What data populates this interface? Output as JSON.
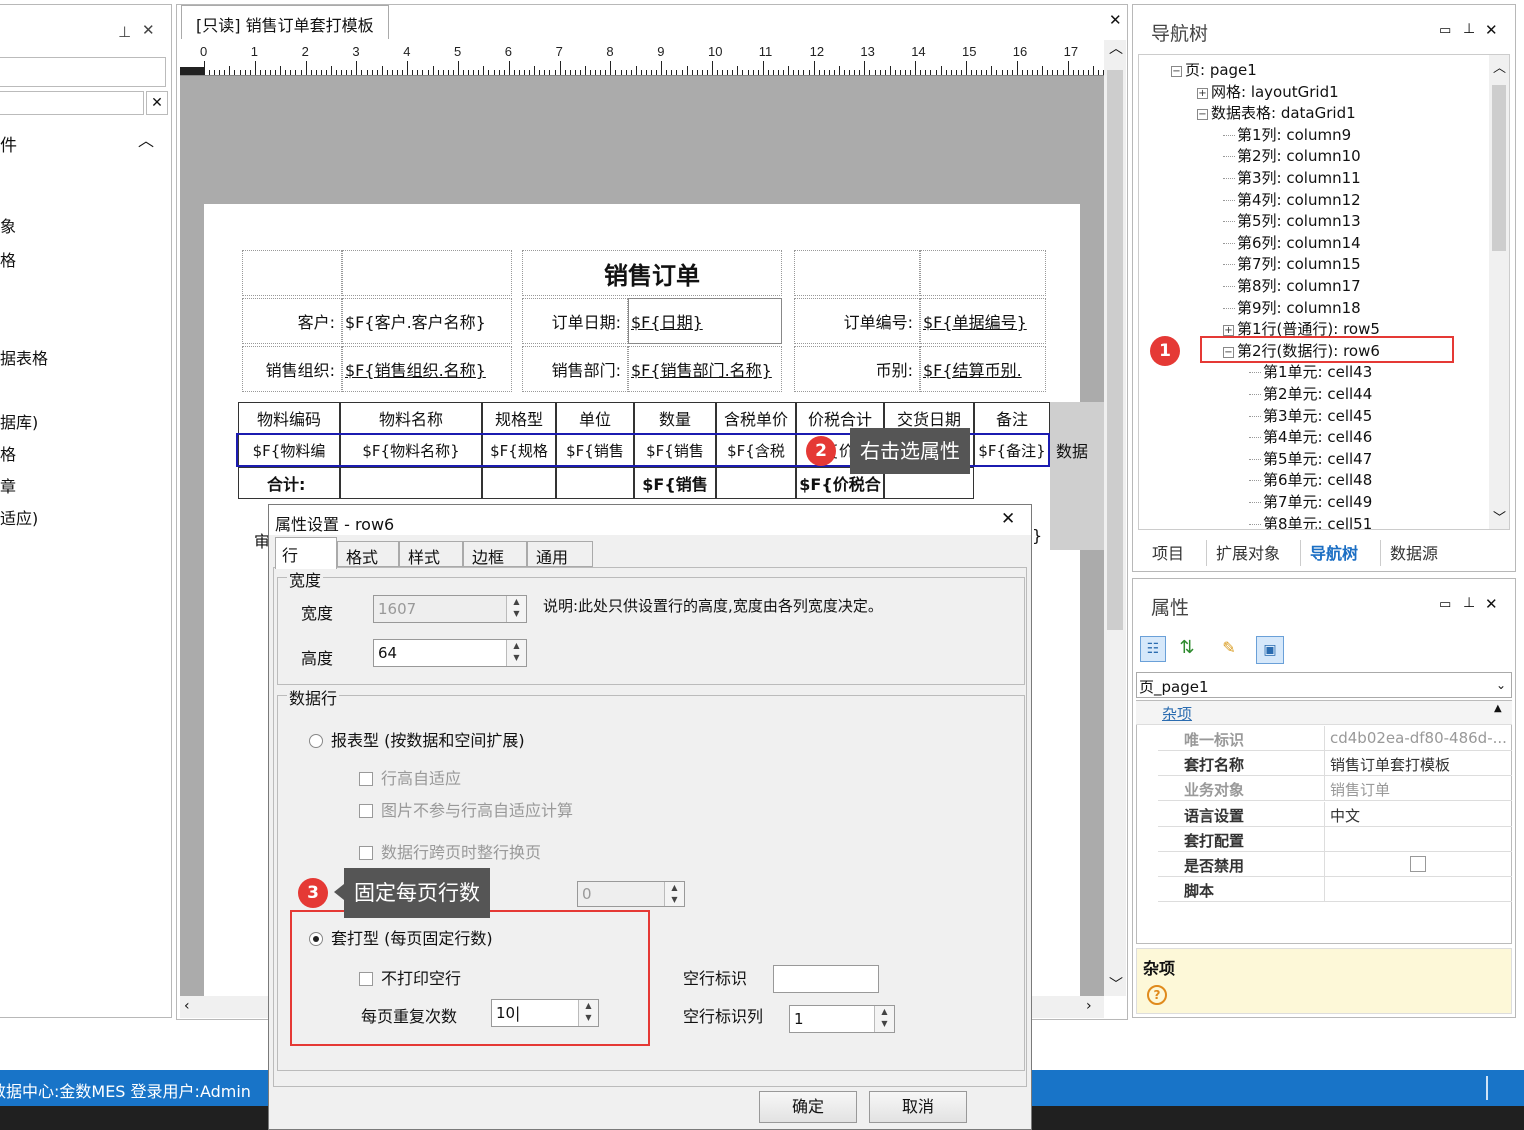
{
  "left_panel": {
    "fragments": [
      "件",
      "象",
      "格",
      "据表格",
      "据库)",
      "格",
      "章",
      "适应)"
    ]
  },
  "document_tab": {
    "title": "[只读] 销售订单套打模板"
  },
  "ruler": {
    "ticks": [
      "0",
      "1",
      "2",
      "3",
      "4",
      "5",
      "6",
      "7",
      "8",
      "9",
      "10",
      "11",
      "12",
      "13",
      "14",
      "15",
      "16",
      "17"
    ]
  },
  "report": {
    "title": "销售订单",
    "labels": {
      "customer": "客户:",
      "order_date": "订单日期:",
      "order_no": "订单编号:",
      "sales_org": "销售组织:",
      "sales_dept": "销售部门:",
      "currency": "币别:"
    },
    "fields": {
      "customer": "$F{客户.客户名称}",
      "order_date": "$F{日期}",
      "order_no": "$F{单据编号}",
      "sales_org": "$F{销售组织.名称}",
      "sales_dept": "$F{销售部门.名称}",
      "currency": "$F{结算币别."
    },
    "headers": [
      "物料编码",
      "物料名称",
      "规格型",
      "单位",
      "数量",
      "含税单价",
      "价税合计",
      "交货日期",
      "备注"
    ],
    "data_row": [
      "$F{物料编",
      "$F{物料名称}",
      "$F{规格",
      "$F{销售",
      "$F{销售",
      "$F{含税",
      "$F{价税",
      "",
      "$F{备注}"
    ],
    "data_row_tag": "数据",
    "total_label": "合计:",
    "total_qty": "$F{销售",
    "total_amount": "$F{价税合",
    "partial_label": "审",
    "partial_right": "}"
  },
  "nav_tree": {
    "title": "导航树",
    "nodes": [
      {
        "text": "页: page1",
        "expander": "−"
      },
      {
        "text": "网格: layoutGrid1",
        "expander": "+"
      },
      {
        "text": "数据表格: dataGrid1",
        "expander": "−"
      },
      {
        "text": "第1列: column9",
        "expander": ""
      },
      {
        "text": "第2列: column10",
        "expander": ""
      },
      {
        "text": "第3列: column11",
        "expander": ""
      },
      {
        "text": "第4列: column12",
        "expander": ""
      },
      {
        "text": "第5列: column13",
        "expander": ""
      },
      {
        "text": "第6列: column14",
        "expander": ""
      },
      {
        "text": "第7列: column15",
        "expander": ""
      },
      {
        "text": "第8列: column17",
        "expander": ""
      },
      {
        "text": "第9列: column18",
        "expander": ""
      },
      {
        "text": "第1行(普通行): row5",
        "expander": "+"
      },
      {
        "text": "第2行(数据行): row6",
        "expander": "−"
      },
      {
        "text": "第1单元: cell43",
        "expander": ""
      },
      {
        "text": "第2单元: cell44",
        "expander": ""
      },
      {
        "text": "第3单元: cell45",
        "expander": ""
      },
      {
        "text": "第4单元: cell46",
        "expander": ""
      },
      {
        "text": "第5单元: cell47",
        "expander": ""
      },
      {
        "text": "第6单元: cell48",
        "expander": ""
      },
      {
        "text": "第7单元: cell49",
        "expander": ""
      },
      {
        "text": "第8单元: cell51",
        "expander": ""
      }
    ],
    "tabs": [
      "项目",
      "扩展对象",
      "导航树",
      "数据源"
    ],
    "active_tab": "导航树"
  },
  "properties": {
    "title": "属性",
    "selector": "页_page1",
    "category": "杂项",
    "rows": [
      {
        "key": "唯一标识",
        "value": "cd4b02ea-df80-486d-...",
        "disabled": true
      },
      {
        "key": "套打名称",
        "value": "销售订单套打模板",
        "disabled": false
      },
      {
        "key": "业务对象",
        "value": "销售订单",
        "disabled": true
      },
      {
        "key": "语言设置",
        "value": "中文",
        "disabled": false
      },
      {
        "key": "套打配置",
        "value": "",
        "disabled": false
      },
      {
        "key": "是否禁用",
        "value": "",
        "disabled": false
      },
      {
        "key": "脚本",
        "value": "",
        "disabled": false
      }
    ],
    "desc_title": "杂项"
  },
  "status_bar": {
    "text": "数据中心:金数MES  登录用户:Admin"
  },
  "dialog": {
    "title": "属性设置 - row6",
    "tabs": [
      "行",
      "格式",
      "样式",
      "边框",
      "通用"
    ],
    "active_tab": "行",
    "width_group": "宽度",
    "width_label": "宽度",
    "width_value": "1607",
    "height_label": "高度",
    "height_value": "64",
    "note": "说明:此处只供设置行的高度,宽度由各列宽度决定。",
    "data_group": "数据行",
    "report_type": "报表型 (按数据和空间扩展)",
    "row_auto": "行高自适应",
    "img_no_auto": "图片不参与行高自适应计算",
    "cross_page": "数据行跨页时整行换页",
    "disabled_spin": "0",
    "print_type": "套打型 (每页固定行数)",
    "no_print_empty": "不打印空行",
    "repeat_label": "每页重复次数",
    "repeat_value": "10",
    "empty_flag_label": "空行标识",
    "empty_flag_value": "",
    "empty_col_label": "空行标识列",
    "empty_col_value": "1",
    "ok": "确定",
    "cancel": "取消"
  },
  "annotations": {
    "b1": "1",
    "b2": "2",
    "b2_text": "右击选属性",
    "b3": "3",
    "b3_text": "固定每页行数"
  }
}
